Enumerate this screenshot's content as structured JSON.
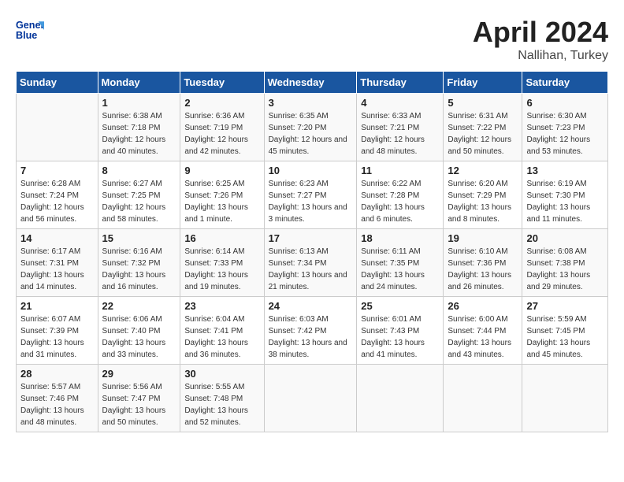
{
  "header": {
    "logo_line1": "General",
    "logo_line2": "Blue",
    "title": "April 2024",
    "subtitle": "Nallihan, Turkey"
  },
  "weekdays": [
    "Sunday",
    "Monday",
    "Tuesday",
    "Wednesday",
    "Thursday",
    "Friday",
    "Saturday"
  ],
  "weeks": [
    [
      {
        "day": "",
        "sunrise": "",
        "sunset": "",
        "daylight": ""
      },
      {
        "day": "1",
        "sunrise": "Sunrise: 6:38 AM",
        "sunset": "Sunset: 7:18 PM",
        "daylight": "Daylight: 12 hours and 40 minutes."
      },
      {
        "day": "2",
        "sunrise": "Sunrise: 6:36 AM",
        "sunset": "Sunset: 7:19 PM",
        "daylight": "Daylight: 12 hours and 42 minutes."
      },
      {
        "day": "3",
        "sunrise": "Sunrise: 6:35 AM",
        "sunset": "Sunset: 7:20 PM",
        "daylight": "Daylight: 12 hours and 45 minutes."
      },
      {
        "day": "4",
        "sunrise": "Sunrise: 6:33 AM",
        "sunset": "Sunset: 7:21 PM",
        "daylight": "Daylight: 12 hours and 48 minutes."
      },
      {
        "day": "5",
        "sunrise": "Sunrise: 6:31 AM",
        "sunset": "Sunset: 7:22 PM",
        "daylight": "Daylight: 12 hours and 50 minutes."
      },
      {
        "day": "6",
        "sunrise": "Sunrise: 6:30 AM",
        "sunset": "Sunset: 7:23 PM",
        "daylight": "Daylight: 12 hours and 53 minutes."
      }
    ],
    [
      {
        "day": "7",
        "sunrise": "Sunrise: 6:28 AM",
        "sunset": "Sunset: 7:24 PM",
        "daylight": "Daylight: 12 hours and 56 minutes."
      },
      {
        "day": "8",
        "sunrise": "Sunrise: 6:27 AM",
        "sunset": "Sunset: 7:25 PM",
        "daylight": "Daylight: 12 hours and 58 minutes."
      },
      {
        "day": "9",
        "sunrise": "Sunrise: 6:25 AM",
        "sunset": "Sunset: 7:26 PM",
        "daylight": "Daylight: 13 hours and 1 minute."
      },
      {
        "day": "10",
        "sunrise": "Sunrise: 6:23 AM",
        "sunset": "Sunset: 7:27 PM",
        "daylight": "Daylight: 13 hours and 3 minutes."
      },
      {
        "day": "11",
        "sunrise": "Sunrise: 6:22 AM",
        "sunset": "Sunset: 7:28 PM",
        "daylight": "Daylight: 13 hours and 6 minutes."
      },
      {
        "day": "12",
        "sunrise": "Sunrise: 6:20 AM",
        "sunset": "Sunset: 7:29 PM",
        "daylight": "Daylight: 13 hours and 8 minutes."
      },
      {
        "day": "13",
        "sunrise": "Sunrise: 6:19 AM",
        "sunset": "Sunset: 7:30 PM",
        "daylight": "Daylight: 13 hours and 11 minutes."
      }
    ],
    [
      {
        "day": "14",
        "sunrise": "Sunrise: 6:17 AM",
        "sunset": "Sunset: 7:31 PM",
        "daylight": "Daylight: 13 hours and 14 minutes."
      },
      {
        "day": "15",
        "sunrise": "Sunrise: 6:16 AM",
        "sunset": "Sunset: 7:32 PM",
        "daylight": "Daylight: 13 hours and 16 minutes."
      },
      {
        "day": "16",
        "sunrise": "Sunrise: 6:14 AM",
        "sunset": "Sunset: 7:33 PM",
        "daylight": "Daylight: 13 hours and 19 minutes."
      },
      {
        "day": "17",
        "sunrise": "Sunrise: 6:13 AM",
        "sunset": "Sunset: 7:34 PM",
        "daylight": "Daylight: 13 hours and 21 minutes."
      },
      {
        "day": "18",
        "sunrise": "Sunrise: 6:11 AM",
        "sunset": "Sunset: 7:35 PM",
        "daylight": "Daylight: 13 hours and 24 minutes."
      },
      {
        "day": "19",
        "sunrise": "Sunrise: 6:10 AM",
        "sunset": "Sunset: 7:36 PM",
        "daylight": "Daylight: 13 hours and 26 minutes."
      },
      {
        "day": "20",
        "sunrise": "Sunrise: 6:08 AM",
        "sunset": "Sunset: 7:38 PM",
        "daylight": "Daylight: 13 hours and 29 minutes."
      }
    ],
    [
      {
        "day": "21",
        "sunrise": "Sunrise: 6:07 AM",
        "sunset": "Sunset: 7:39 PM",
        "daylight": "Daylight: 13 hours and 31 minutes."
      },
      {
        "day": "22",
        "sunrise": "Sunrise: 6:06 AM",
        "sunset": "Sunset: 7:40 PM",
        "daylight": "Daylight: 13 hours and 33 minutes."
      },
      {
        "day": "23",
        "sunrise": "Sunrise: 6:04 AM",
        "sunset": "Sunset: 7:41 PM",
        "daylight": "Daylight: 13 hours and 36 minutes."
      },
      {
        "day": "24",
        "sunrise": "Sunrise: 6:03 AM",
        "sunset": "Sunset: 7:42 PM",
        "daylight": "Daylight: 13 hours and 38 minutes."
      },
      {
        "day": "25",
        "sunrise": "Sunrise: 6:01 AM",
        "sunset": "Sunset: 7:43 PM",
        "daylight": "Daylight: 13 hours and 41 minutes."
      },
      {
        "day": "26",
        "sunrise": "Sunrise: 6:00 AM",
        "sunset": "Sunset: 7:44 PM",
        "daylight": "Daylight: 13 hours and 43 minutes."
      },
      {
        "day": "27",
        "sunrise": "Sunrise: 5:59 AM",
        "sunset": "Sunset: 7:45 PM",
        "daylight": "Daylight: 13 hours and 45 minutes."
      }
    ],
    [
      {
        "day": "28",
        "sunrise": "Sunrise: 5:57 AM",
        "sunset": "Sunset: 7:46 PM",
        "daylight": "Daylight: 13 hours and 48 minutes."
      },
      {
        "day": "29",
        "sunrise": "Sunrise: 5:56 AM",
        "sunset": "Sunset: 7:47 PM",
        "daylight": "Daylight: 13 hours and 50 minutes."
      },
      {
        "day": "30",
        "sunrise": "Sunrise: 5:55 AM",
        "sunset": "Sunset: 7:48 PM",
        "daylight": "Daylight: 13 hours and 52 minutes."
      },
      {
        "day": "",
        "sunrise": "",
        "sunset": "",
        "daylight": ""
      },
      {
        "day": "",
        "sunrise": "",
        "sunset": "",
        "daylight": ""
      },
      {
        "day": "",
        "sunrise": "",
        "sunset": "",
        "daylight": ""
      },
      {
        "day": "",
        "sunrise": "",
        "sunset": "",
        "daylight": ""
      }
    ]
  ]
}
